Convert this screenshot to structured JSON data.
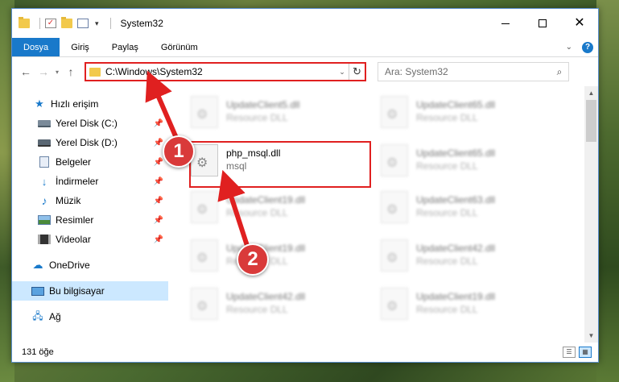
{
  "window": {
    "title": "System32",
    "controls": {
      "minimize_icon": "minimize-icon",
      "maximize_icon": "maximize-icon",
      "close_icon": "close-icon"
    }
  },
  "ribbon": {
    "tabs": [
      "Dosya",
      "Giriş",
      "Paylaş",
      "Görünüm"
    ],
    "active_tab": "Dosya"
  },
  "nav": {
    "address": "C:\\Windows\\System32",
    "search_placeholder": "Ara: System32"
  },
  "sidebar": {
    "quick_access": "Hızlı erişim",
    "items": [
      {
        "label": "Yerel Disk (C:)",
        "icon": "drive-icon",
        "pinned": true
      },
      {
        "label": "Yerel Disk (D:)",
        "icon": "drive-icon",
        "pinned": true
      },
      {
        "label": "Belgeler",
        "icon": "documents-icon",
        "pinned": true
      },
      {
        "label": "İndirmeler",
        "icon": "downloads-icon",
        "pinned": true
      },
      {
        "label": "Müzik",
        "icon": "music-icon",
        "pinned": true
      },
      {
        "label": "Resimler",
        "icon": "pictures-icon",
        "pinned": true
      },
      {
        "label": "Videolar",
        "icon": "videos-icon",
        "pinned": true
      }
    ],
    "onedrive": "OneDrive",
    "this_pc": "Bu bilgisayar",
    "network": "Ağ"
  },
  "files": {
    "highlighted": {
      "name": "php_msql.dll",
      "type": "msql"
    },
    "left_column": [
      {
        "name": "UpdateClient5.dll",
        "type": "Resource DLL"
      },
      {
        "name": "UpdateClient19.dll",
        "type": "Resource DLL"
      },
      {
        "name": "UpdateClient19.dll",
        "type": "Resource DLL"
      },
      {
        "name": "UpdateClient42.dll",
        "type": "Resource DLL"
      }
    ],
    "right_column": [
      {
        "name": "UpdateClient65.dll",
        "type": "Resource DLL"
      },
      {
        "name": "UpdateClient65.dll",
        "type": "Resource DLL"
      },
      {
        "name": "UpdateClient63.dll",
        "type": "Resource DLL"
      },
      {
        "name": "UpdateClient42.dll",
        "type": "Resource DLL"
      },
      {
        "name": "UpdateClient19.dll",
        "type": "Resource DLL"
      }
    ]
  },
  "status": {
    "item_count": "131 öğe"
  },
  "annotations": {
    "step1": "1",
    "step2": "2",
    "color": "#e02020"
  }
}
